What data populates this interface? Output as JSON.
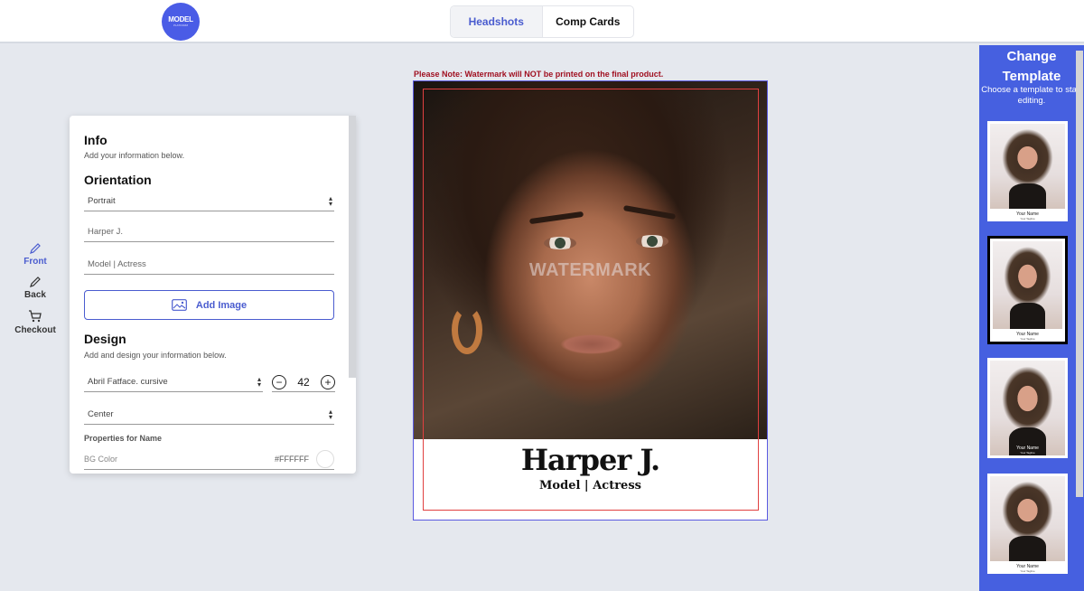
{
  "header": {
    "logo_text": "MODEL",
    "logo_subtext": "PLATFORM",
    "tabs": [
      {
        "label": "Headshots",
        "active": true
      },
      {
        "label": "Comp Cards",
        "active": false
      }
    ]
  },
  "leftnav": {
    "items": [
      {
        "label": "Front",
        "icon": "pencil-icon",
        "active": true
      },
      {
        "label": "Back",
        "icon": "pencil-icon",
        "active": false
      },
      {
        "label": "Checkout",
        "icon": "cart-icon",
        "active": false
      }
    ]
  },
  "panel": {
    "info_title": "Info",
    "info_sub": "Add your information below.",
    "orientation_title": "Orientation",
    "orientation_value": "Portrait",
    "name_value": "Harper J.",
    "title_value": "Model | Actress",
    "add_image_label": "Add Image",
    "design_title": "Design",
    "design_sub": "Add and design your information below.",
    "font_value": "Abril Fatface. cursive",
    "font_size": "42",
    "align_value": "Center",
    "properties_label": "Properties for Name",
    "bg_color_label": "BG Color",
    "bg_color_value": "#FFFFFF"
  },
  "preview": {
    "note": "Please Note: Watermark will NOT be printed on the final product.",
    "watermark": "WATERMARK",
    "name": "Harper J.",
    "title": "Model | Actress"
  },
  "templates": {
    "title": "Change Template",
    "subtitle": "Choose a template to start editing.",
    "items": [
      {
        "name": "Your Name",
        "tagline": "Your Tagline",
        "selected": false
      },
      {
        "name": "Your Name",
        "tagline": "Your Tagline",
        "selected": true
      },
      {
        "name": "Your Name",
        "tagline": "Your Tagline",
        "selected": false
      },
      {
        "name": "Your Name",
        "tagline": "Your Tagline",
        "selected": false
      }
    ]
  },
  "colors": {
    "accent": "#4a5ccf",
    "sidebar": "#4660e0",
    "note": "#a01020"
  }
}
